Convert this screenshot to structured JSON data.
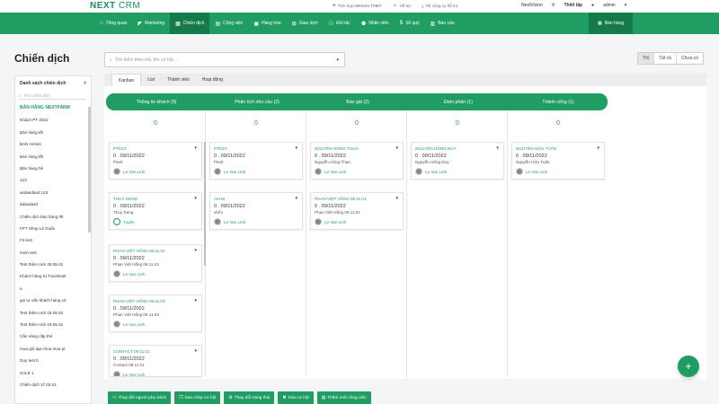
{
  "brand": {
    "logo_main": "NEXT",
    "logo_sub": "CRM",
    "color": "#1f9d62"
  },
  "toplinks": [
    {
      "icon": "globe-icon",
      "label": "Tích hợp Website TMĐT"
    },
    {
      "icon": "support-icon",
      "label": "Hỗ trợ"
    },
    {
      "icon": "download-icon",
      "label": "Tải công cụ hỗ trợ"
    }
  ],
  "topright": {
    "company": "NextVision",
    "settings": "Thiết lập",
    "user": "admin"
  },
  "nav": [
    {
      "icon": "home-icon",
      "label": "Tổng quan"
    },
    {
      "icon": "megaphone-icon",
      "label": "Marketing"
    },
    {
      "icon": "campaign-icon",
      "label": "Chiến dịch",
      "active": true
    },
    {
      "icon": "task-icon",
      "label": "Công việc"
    },
    {
      "icon": "box-icon",
      "label": "Hàng hóa"
    },
    {
      "icon": "cart-icon",
      "label": "Giao dịch"
    },
    {
      "icon": "partner-icon",
      "label": "Đối tác"
    },
    {
      "icon": "staff-icon",
      "label": "Nhân viên"
    },
    {
      "icon": "cash-icon",
      "label": "Sổ quỹ"
    },
    {
      "icon": "report-icon",
      "label": "Báo cáo"
    }
  ],
  "nav_right": "Bán hàng",
  "page_title": "Chiến dịch",
  "search": {
    "placeholder": "Tìm kiếm theo mã, tên cơ hội..."
  },
  "filters": [
    "Tôi",
    "Tất cả",
    "Chưa có"
  ],
  "sidebar": {
    "title": "Danh sách chiến dịch",
    "search_placeholder": "Tìm chiến dịch",
    "items": [
      "BÁN HÀNG NEXTFARM",
      "Khách PT 2021",
      "Bán hàng tết",
      "BAN HÀNG",
      "Bán hàng tết",
      "Bán hàng hè",
      "123",
      "asdasdasd 123",
      "ádasdasd",
      "Chiến dịch bán hàng tết",
      "FPT Shop Lê Duẩn",
      "Fit test",
      "minh test",
      "Test thêm mới 29.05.01",
      "Khách hàng từ Facebook",
      "a",
      "gọi tư vấn khách hàng cũ",
      "Test thêm mới 19.05.02",
      "Test thêm mới 19.05.01",
      "Cần nâng cấp thẻ",
      "mua gói tạp chua mua pt",
      "Duy test 5",
      "SALE 1",
      "Chiến dịch 17.03.01"
    ]
  },
  "tabs": [
    "Kanban",
    "List",
    "Thành viên",
    "Hoạt động"
  ],
  "stages": [
    {
      "label": "Thông tin khách (9)",
      "count": "0"
    },
    {
      "label": "Phân tích nhu cầu (2)",
      "count": "0"
    },
    {
      "label": "Báo giá (2)",
      "count": "0"
    },
    {
      "label": "Đàm phán (1)",
      "count": "0"
    },
    {
      "label": "Thành công (1)",
      "count": "0"
    }
  ],
  "cards": [
    [
      {
        "title": "PTEST",
        "date": "0 . 09/11/2022",
        "name": "Ptest",
        "user": "Le Van Linh"
      },
      {
        "title": "THUY DUNG",
        "date": "0 . 09/11/2022",
        "name": "Thuy Dung",
        "user": "Tuyến"
      },
      {
        "title": "PHAN VIỆT HẰNG 09.11.02",
        "date": "0 . 09/11/2022",
        "name": "Phan Việt Hằng 09.11.02",
        "user": "Le Van Linh"
      },
      {
        "title": "PHAN VIỆT HẰNG 09.11.03",
        "date": "0 . 09/11/2022",
        "name": "Phan Việt Hằng 09.11.03",
        "user": "Le Van Linh"
      },
      {
        "title": "CONTACT 09.11.01",
        "date": "0 . 09/11/2022",
        "name": "Contact 09.11.01",
        "user": "Le Van Linh"
      }
    ],
    [
      {
        "title": "PTEST",
        "date": "0 . 09/11/2022",
        "name": "Ptest",
        "user": "Le Van Linh"
      },
      {
        "title": "AHIHI",
        "date": "0 . 09/11/2022",
        "name": "ahihi",
        "user": "Le Van Linh"
      }
    ],
    [
      {
        "title": "NGUYỄN HỒNG THAO",
        "date": "0 . 09/11/2022",
        "name": "Nguyễn Hồng Thao",
        "user": "Le Van Linh"
      },
      {
        "title": "PHAN VIỆT HẰNG 09.11.01",
        "date": "0 . 09/11/2022",
        "name": "Phan Việt Hằng 09.11.01",
        "user": "Le Van Linh"
      }
    ],
    [
      {
        "title": "NGUYỄN HỒNG DUY",
        "date": "0 . 09/11/2022",
        "name": "Nguyễn Hồng Duy",
        "user": "Le Van Linh"
      }
    ],
    [
      {
        "title": "NGUYỄN HỮU TUẤN",
        "date": "0 . 09/11/2022",
        "name": "Nguyễn Hữu Tuấn",
        "user": "Le Van Linh"
      }
    ]
  ],
  "actions": [
    {
      "icon": "users-icon",
      "label": "Thay đổi người phụ trách"
    },
    {
      "icon": "copy-icon",
      "label": "Sao chép cơ hội"
    },
    {
      "icon": "gears-icon",
      "label": "Thay đổi trạng thái"
    },
    {
      "icon": "trash-icon",
      "label": "Xóa cơ hội"
    },
    {
      "icon": "task-add-icon",
      "label": "Thêm mới công việc"
    }
  ],
  "fab_label": "+"
}
